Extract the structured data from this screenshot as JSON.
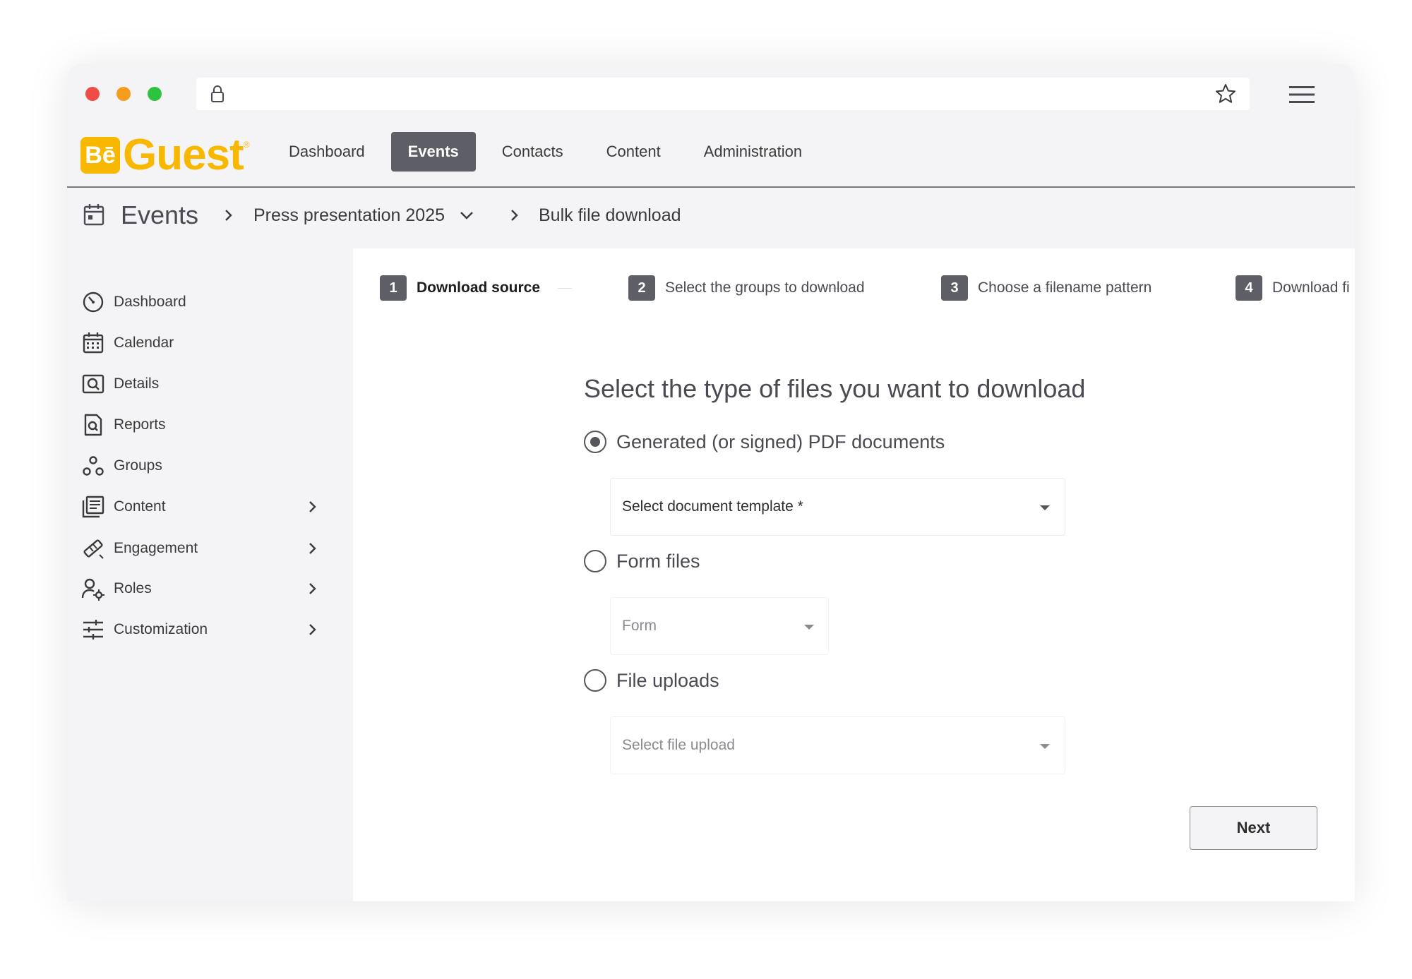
{
  "browser": {
    "url": ""
  },
  "header": {
    "logo_text": "BēGuest",
    "nav": [
      {
        "label": "Dashboard",
        "active": false
      },
      {
        "label": "Events",
        "active": true
      },
      {
        "label": "Contacts",
        "active": false
      },
      {
        "label": "Content",
        "active": false
      },
      {
        "label": "Administration",
        "active": false
      }
    ]
  },
  "breadcrumb": {
    "root": "Events",
    "event": "Press presentation 2025",
    "page": "Bulk file download"
  },
  "sidebar": {
    "items": [
      {
        "label": "Dashboard",
        "icon": "dashboard-icon",
        "has_submenu": false
      },
      {
        "label": "Calendar",
        "icon": "calendar-icon",
        "has_submenu": false
      },
      {
        "label": "Details",
        "icon": "details-icon",
        "has_submenu": false
      },
      {
        "label": "Reports",
        "icon": "reports-icon",
        "has_submenu": false
      },
      {
        "label": "Groups",
        "icon": "groups-icon",
        "has_submenu": false
      },
      {
        "label": "Content",
        "icon": "content-icon",
        "has_submenu": true
      },
      {
        "label": "Engagement",
        "icon": "engagement-icon",
        "has_submenu": true
      },
      {
        "label": "Roles",
        "icon": "roles-icon",
        "has_submenu": true
      },
      {
        "label": "Customization",
        "icon": "customization-icon",
        "has_submenu": true
      }
    ]
  },
  "stepper": {
    "steps": [
      {
        "num": "1",
        "label": "Download source",
        "active": true
      },
      {
        "num": "2",
        "label": "Select the groups to download",
        "active": false
      },
      {
        "num": "3",
        "label": "Choose a filename pattern",
        "active": false
      },
      {
        "num": "4",
        "label": "Download fi",
        "active": false
      }
    ]
  },
  "form": {
    "heading": "Select the type of files you want to download",
    "options": [
      {
        "label": "Generated (or signed) PDF documents",
        "checked": true,
        "select_placeholder": "Select document template *"
      },
      {
        "label": "Form files",
        "checked": false,
        "select_placeholder": "Form"
      },
      {
        "label": "File uploads",
        "checked": false,
        "select_placeholder": "Select file upload"
      }
    ],
    "next_label": "Next"
  },
  "colors": {
    "brand": "#f9b800",
    "nav_active": "#5e5e66",
    "traffic_red": "#ee4c45",
    "traffic_yellow": "#f59c1c",
    "traffic_green": "#2ec33f"
  }
}
